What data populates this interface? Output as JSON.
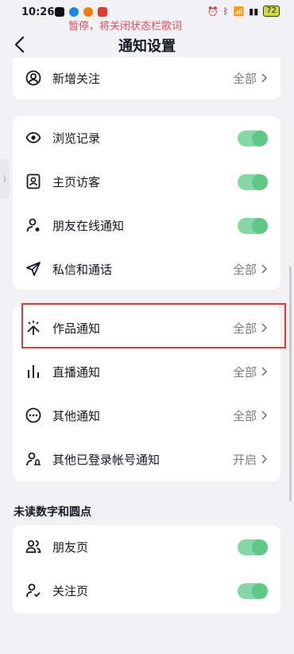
{
  "status_bar": {
    "time": "10:26",
    "lyric": "暂停，将关闭状态栏歌词",
    "battery": "72",
    "app_colors": [
      "#111111",
      "#1e88e5",
      "#f57c00",
      "#e53935"
    ]
  },
  "header": {
    "title": "通知设置"
  },
  "card_top": {
    "items": [
      {
        "label": "新增关注",
        "value": "全部"
      }
    ]
  },
  "card_privacy": {
    "items": [
      {
        "label": "浏览记录",
        "toggle": true
      },
      {
        "label": "主页访客",
        "toggle": true
      },
      {
        "label": "朋友在线通知",
        "toggle": true
      },
      {
        "label": "私信和通话",
        "value": "全部"
      }
    ]
  },
  "card_content": {
    "items": [
      {
        "label": "作品通知",
        "value": "全部"
      },
      {
        "label": "直播通知",
        "value": "全部"
      },
      {
        "label": "其他通知",
        "value": "全部"
      },
      {
        "label": "其他已登录帐号通知",
        "value": "开启"
      }
    ]
  },
  "unread_section": {
    "title": "未读数字和圆点",
    "items": [
      {
        "label": "朋友页",
        "toggle": true
      },
      {
        "label": "关注页",
        "toggle": true
      }
    ]
  },
  "colors": {
    "toggle_on": "#5fc887",
    "highlight": "#e53935"
  }
}
